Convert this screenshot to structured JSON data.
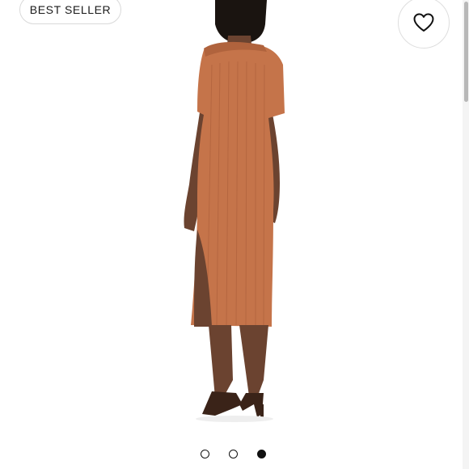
{
  "badge": {
    "label": "BEST SELLER"
  },
  "wishlist": {
    "icon": "heart-icon"
  },
  "carousel": {
    "total": 3,
    "active_index": 2
  },
  "colors": {
    "dress": "#c5744a",
    "badge_border": "#d9d9d9",
    "dot_active": "#111111"
  }
}
